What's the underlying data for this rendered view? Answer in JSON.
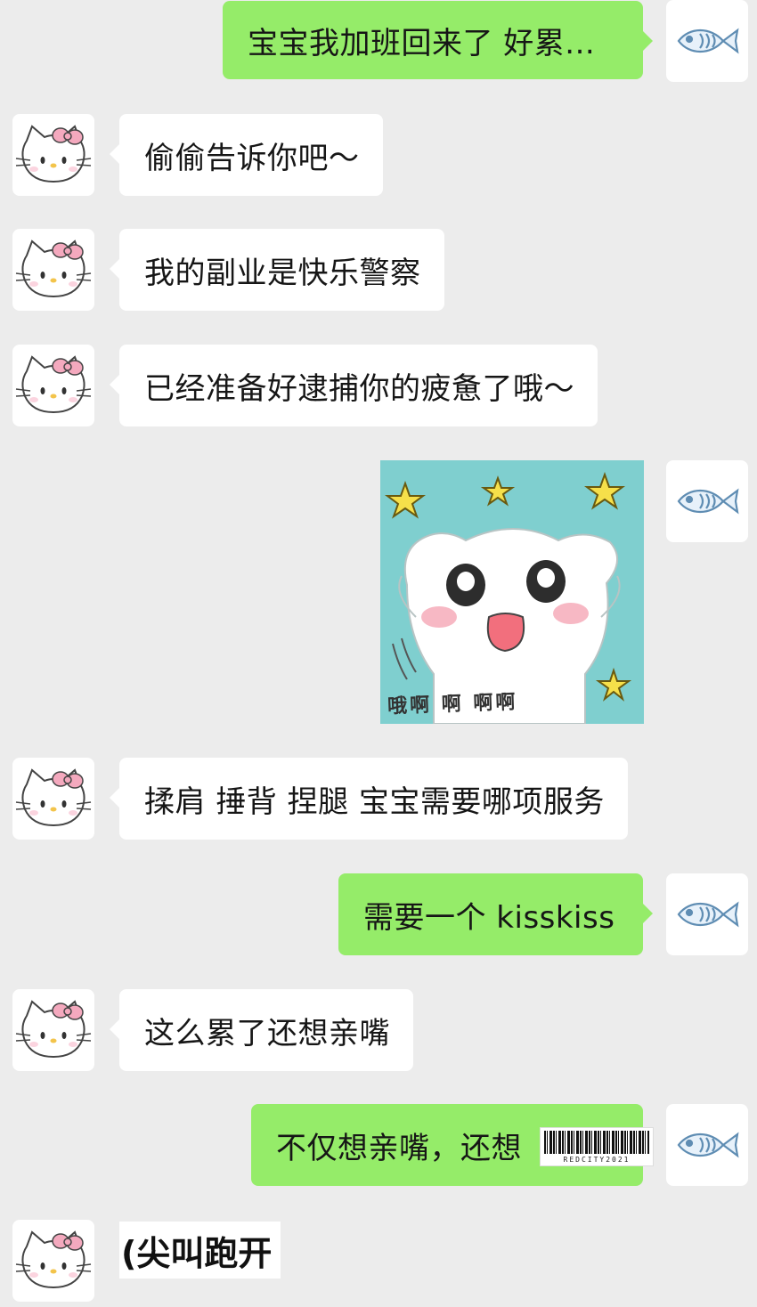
{
  "messages": [
    {
      "sender": "me",
      "text": "宝宝我加班回来了 好累..."
    },
    {
      "sender": "partner",
      "text": "偷偷告诉你吧～"
    },
    {
      "sender": "partner",
      "text": "我的副业是快乐警察"
    },
    {
      "sender": "partner",
      "text": "已经准备好逮捕你的疲惫了哦～"
    },
    {
      "sender": "me",
      "type": "sticker",
      "sticker_text": "哦啊 啊 啊啊"
    },
    {
      "sender": "partner",
      "text": "揉肩 捶背 捏腿 宝宝需要哪项服务"
    },
    {
      "sender": "me",
      "text": "需要一个 kisskiss"
    },
    {
      "sender": "partner",
      "text": "这么累了还想亲嘴"
    },
    {
      "sender": "me",
      "text": "不仅想亲嘴，还想"
    },
    {
      "sender": "partner",
      "text": "(尖叫跑开"
    }
  ],
  "watermark": {
    "label": "REDCITY2021"
  },
  "avatars": {
    "me": "fish-icon",
    "partner": "hello-kitty-avatar"
  },
  "colors": {
    "background": "#ececec",
    "outgoing_bubble": "#95ec69",
    "incoming_bubble": "#ffffff"
  }
}
